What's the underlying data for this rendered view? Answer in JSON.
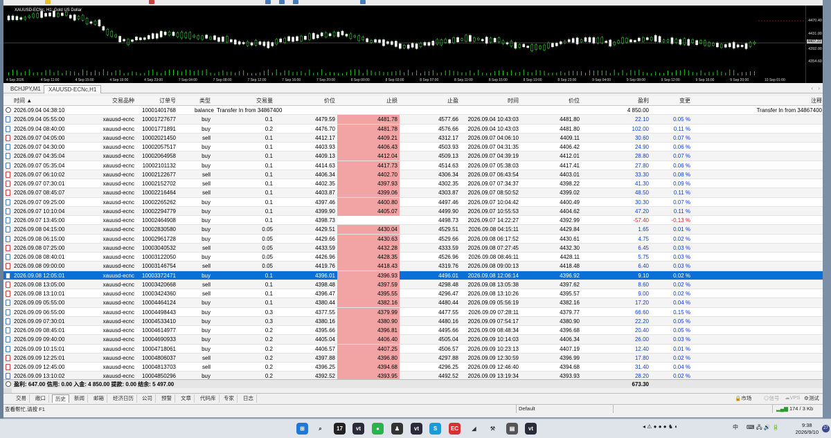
{
  "chart": {
    "title": "XAUUSD-ECNc, H1:  Gold US Dollar",
    "scale_labels": [
      "4470.40",
      "4431.00",
      "4407.22",
      "4392.00",
      "4354.60"
    ],
    "current_price": "4407.22",
    "time_labels": [
      "4 Sep 2026",
      "4 Sep 11:00",
      "4 Sep 15:00",
      "4 Sep 19:00",
      "4 Sep 23:00",
      "7 Sep 04:00",
      "7 Sep 08:00",
      "7 Sep 12:00",
      "7 Sep 16:00",
      "7 Sep 20:00",
      "8 Sep 00:00",
      "8 Sep 03:00",
      "8 Sep 07:00",
      "8 Sep 11:00",
      "8 Sep 15:00",
      "8 Sep 19:00",
      "8 Sep 23:00",
      "9 Sep 04:00",
      "9 Sep 08:00",
      "9 Sep 12:00",
      "9 Sep 16:00",
      "9 Sep 20:00",
      "10 Sep 01:00"
    ]
  },
  "chart_tabs": [
    "BCHJPY,M1",
    "XAUUSD-ECNc,H1"
  ],
  "columns": [
    "时间",
    "交易品种",
    "订单号",
    "类型",
    "交易量",
    "价位",
    "止损",
    "止盈",
    "时间",
    "价位",
    "盈利",
    "变更",
    "注释"
  ],
  "deposit": {
    "time": "2026.09.04 04:38:10",
    "order": "10001401768",
    "type": "balance",
    "comment": "Transfer In from 34867400",
    "profit": "4 850.00",
    "note": "Transfer In from 34867400"
  },
  "rows": [
    {
      "t": "2026.09.04 05:55:00",
      "sym": "xauusd-ecnc",
      "id": "10001727677",
      "type": "buy",
      "vol": "0.1",
      "p": "4479.59",
      "sl": "4481.78",
      "tp": "4577.66",
      "t2": "2026.09.04 10:43:03",
      "p2": "4481.80",
      "pr": "22.10",
      "ch": "0.05 %"
    },
    {
      "t": "2026.09.04 08:40:00",
      "sym": "xauusd-ecnc",
      "id": "10001771891",
      "type": "buy",
      "vol": "0.2",
      "p": "4476.70",
      "sl": "4481.78",
      "tp": "4576.66",
      "t2": "2026.09.04 10:43:03",
      "p2": "4481.80",
      "pr": "102.00",
      "ch": "0.11 %"
    },
    {
      "t": "2026.09.07 04:05:00",
      "sym": "xauusd-ecnc",
      "id": "10002021450",
      "type": "sell",
      "vol": "0.1",
      "p": "4412.17",
      "sl": "4409.21",
      "tp": "4312.17",
      "t2": "2026.09.07 04:06:10",
      "p2": "4409.11",
      "pr": "30.60",
      "ch": "0.07 %"
    },
    {
      "t": "2026.09.07 04:30:00",
      "sym": "xauusd-ecnc",
      "id": "10002057517",
      "type": "buy",
      "vol": "0.1",
      "p": "4403.93",
      "sl": "4406.43",
      "tp": "4503.93",
      "t2": "2026.09.07 04:31:35",
      "p2": "4406.42",
      "pr": "24.90",
      "ch": "0.06 %"
    },
    {
      "t": "2026.09.07 04:35:04",
      "sym": "xauusd-ecnc",
      "id": "10002064958",
      "type": "buy",
      "vol": "0.1",
      "p": "4409.13",
      "sl": "4412.04",
      "tp": "4509.13",
      "t2": "2026.09.07 04:39:19",
      "p2": "4412.01",
      "pr": "28.80",
      "ch": "0.07 %"
    },
    {
      "t": "2026.09.07 05:35:04",
      "sym": "xauusd-ecnc",
      "id": "10002101132",
      "type": "buy",
      "vol": "0.1",
      "p": "4414.63",
      "sl": "4417.73",
      "tp": "4514.63",
      "t2": "2026.09.07 05:38:03",
      "p2": "4417.41",
      "pr": "27.80",
      "ch": "0.06 %"
    },
    {
      "t": "2026.09.07 06:10:02",
      "sym": "xauusd-ecnc",
      "id": "10002122677",
      "type": "sell",
      "vol": "0.1",
      "p": "4406.34",
      "sl": "4402.70",
      "tp": "4306.34",
      "t2": "2026.09.07 06:43:54",
      "p2": "4403.01",
      "pr": "33.30",
      "ch": "0.08 %"
    },
    {
      "t": "2026.09.07 07:30:01",
      "sym": "xauusd-ecnc",
      "id": "10002152702",
      "type": "sell",
      "vol": "0.1",
      "p": "4402.35",
      "sl": "4397.93",
      "tp": "4302.35",
      "t2": "2026.09.07 07:34:37",
      "p2": "4398.22",
      "pr": "41.30",
      "ch": "0.09 %"
    },
    {
      "t": "2026.09.07 08:45:07",
      "sym": "xauusd-ecnc",
      "id": "10002216464",
      "type": "sell",
      "vol": "0.1",
      "p": "4403.87",
      "sl": "4399.06",
      "tp": "4303.87",
      "t2": "2026.09.07 08:50:52",
      "p2": "4399.02",
      "pr": "48.50",
      "ch": "0.11 %"
    },
    {
      "t": "2026.09.07 09:25:00",
      "sym": "xauusd-ecnc",
      "id": "10002265262",
      "type": "buy",
      "vol": "0.1",
      "p": "4397.46",
      "sl": "4400.80",
      "tp": "4497.46",
      "t2": "2026.09.07 10:04:42",
      "p2": "4400.49",
      "pr": "30.30",
      "ch": "0.07 %"
    },
    {
      "t": "2026.09.07 10:10:04",
      "sym": "xauusd-ecnc",
      "id": "10002294779",
      "type": "buy",
      "vol": "0.1",
      "p": "4399.90",
      "sl": "4405.07",
      "tp": "4499.90",
      "t2": "2026.09.07 10:55:53",
      "p2": "4404.62",
      "pr": "47.20",
      "ch": "0.11 %"
    },
    {
      "t": "2026.09.07 13:45:00",
      "sym": "xauusd-ecnc",
      "id": "10002464908",
      "type": "buy",
      "vol": "0.1",
      "p": "4398.73",
      "sl": "",
      "tp": "4498.73",
      "t2": "2026.09.07 14:22:27",
      "p2": "4392.99",
      "pr": "-57.40",
      "ch": "-0.13 %",
      "neg": true
    },
    {
      "t": "2026.09.08 04:15:00",
      "sym": "xauusd-ecnc",
      "id": "10002830580",
      "type": "buy",
      "vol": "0.05",
      "p": "4429.51",
      "sl": "4430.04",
      "tp": "4529.51",
      "t2": "2026.09.08 04:15:11",
      "p2": "4429.84",
      "pr": "1.65",
      "ch": "0.01 %"
    },
    {
      "t": "2026.09.08 06:15:00",
      "sym": "xauusd-ecnc",
      "id": "10002961728",
      "type": "buy",
      "vol": "0.05",
      "p": "4429.66",
      "sl": "4430.63",
      "tp": "4529.66",
      "t2": "2026.09.08 06:17:52",
      "p2": "4430.61",
      "pr": "4.75",
      "ch": "0.02 %"
    },
    {
      "t": "2026.09.08 07:25:00",
      "sym": "xauusd-ecnc",
      "id": "10003040532",
      "type": "sell",
      "vol": "0.05",
      "p": "4433.59",
      "sl": "4432.28",
      "tp": "4333.59",
      "t2": "2026.09.08 07:27:45",
      "p2": "4432.30",
      "pr": "6.45",
      "ch": "0.03 %"
    },
    {
      "t": "2026.09.08 08:40:01",
      "sym": "xauusd-ecnc",
      "id": "10003122050",
      "type": "buy",
      "vol": "0.05",
      "p": "4426.96",
      "sl": "4428.35",
      "tp": "4526.96",
      "t2": "2026.09.08 08:46:11",
      "p2": "4428.11",
      "pr": "5.75",
      "ch": "0.03 %"
    },
    {
      "t": "2026.09.08 09:00:00",
      "sym": "xauusd-ecnc",
      "id": "10003146754",
      "type": "sell",
      "vol": "0.05",
      "p": "4419.76",
      "sl": "4418.43",
      "tp": "4319.76",
      "t2": "2026.09.08 09:00:13",
      "p2": "4418.48",
      "pr": "6.40",
      "ch": "0.03 %"
    },
    {
      "t": "2026.09.08 12:05:01",
      "sym": "xauusd-ecnc",
      "id": "10003372471",
      "type": "buy",
      "vol": "0.1",
      "p": "4396.01",
      "sl": "4396.93",
      "tp": "4496.01",
      "t2": "2026.09.08 12:06:14",
      "p2": "4396.92",
      "pr": "9.10",
      "ch": "0.02 %",
      "sel": true
    },
    {
      "t": "2026.09.08 13:05:00",
      "sym": "xauusd-ecnc",
      "id": "10003420668",
      "type": "sell",
      "vol": "0.1",
      "p": "4398.48",
      "sl": "4397.59",
      "tp": "4298.48",
      "t2": "2026.09.08 13:05:38",
      "p2": "4397.62",
      "pr": "8.60",
      "ch": "0.02 %"
    },
    {
      "t": "2026.09.08 13:10:01",
      "sym": "xauusd-ecnc",
      "id": "10003424360",
      "type": "sell",
      "vol": "0.1",
      "p": "4396.47",
      "sl": "4395.55",
      "tp": "4296.47",
      "t2": "2026.09.08 13:10:26",
      "p2": "4395.57",
      "pr": "9.00",
      "ch": "0.02 %"
    },
    {
      "t": "2026.09.09 05:55:00",
      "sym": "xauusd-ecnc",
      "id": "10004464124",
      "type": "buy",
      "vol": "0.1",
      "p": "4380.44",
      "sl": "4382.16",
      "tp": "4480.44",
      "t2": "2026.09.09 05:56:19",
      "p2": "4382.16",
      "pr": "17.20",
      "ch": "0.04 %"
    },
    {
      "t": "2026.09.09 06:55:00",
      "sym": "xauusd-ecnc",
      "id": "10004498443",
      "type": "buy",
      "vol": "0.3",
      "p": "4377.55",
      "sl": "4379.99",
      "tp": "4477.55",
      "t2": "2026.09.09 07:28:11",
      "p2": "4379.77",
      "pr": "66.60",
      "ch": "0.15 %"
    },
    {
      "t": "2026.09.09 07:30:01",
      "sym": "xauusd-ecnc",
      "id": "10004533410",
      "type": "buy",
      "vol": "0.3",
      "p": "4380.16",
      "sl": "4380.90",
      "tp": "4480.16",
      "t2": "2026.09.09 07:54:17",
      "p2": "4380.90",
      "pr": "22.20",
      "ch": "0.05 %"
    },
    {
      "t": "2026.09.09 08:45:01",
      "sym": "xauusd-ecnc",
      "id": "10004614977",
      "type": "buy",
      "vol": "0.2",
      "p": "4395.66",
      "sl": "4396.81",
      "tp": "4495.66",
      "t2": "2026.09.09 08:48:34",
      "p2": "4396.68",
      "pr": "20.40",
      "ch": "0.05 %"
    },
    {
      "t": "2026.09.09 09:40:00",
      "sym": "xauusd-ecnc",
      "id": "10004690933",
      "type": "buy",
      "vol": "0.2",
      "p": "4405.04",
      "sl": "4406.40",
      "tp": "4505.04",
      "t2": "2026.09.09 10:14:03",
      "p2": "4406.34",
      "pr": "26.00",
      "ch": "0.03 %"
    },
    {
      "t": "2026.09.09 10:15:01",
      "sym": "xauusd-ecnc",
      "id": "10004718061",
      "type": "buy",
      "vol": "0.2",
      "p": "4406.57",
      "sl": "4407.25",
      "tp": "4506.57",
      "t2": "2026.09.09 10:23:13",
      "p2": "4407.19",
      "pr": "12.40",
      "ch": "0.01 %"
    },
    {
      "t": "2026.09.09 12:25:01",
      "sym": "xauusd-ecnc",
      "id": "10004806037",
      "type": "sell",
      "vol": "0.2",
      "p": "4397.88",
      "sl": "4396.80",
      "tp": "4297.88",
      "t2": "2026.09.09 12:30:59",
      "p2": "4396.99",
      "pr": "17.80",
      "ch": "0.02 %"
    },
    {
      "t": "2026.09.09 12:45:00",
      "sym": "xauusd-ecnc",
      "id": "10004813703",
      "type": "sell",
      "vol": "0.2",
      "p": "4396.25",
      "sl": "4394.68",
      "tp": "4296.25",
      "t2": "2026.09.09 12:46:40",
      "p2": "4394.68",
      "pr": "31.40",
      "ch": "0.04 %"
    },
    {
      "t": "2026.09.09 13:10:02",
      "sym": "xauusd-ecnc",
      "id": "10004850296",
      "type": "buy",
      "vol": "0.2",
      "p": "4392.52",
      "sl": "4393.95",
      "tp": "4492.52",
      "t2": "2026.09.09 13:19:34",
      "p2": "4393.93",
      "pr": "28.20",
      "ch": "0.02 %"
    }
  ],
  "summary": {
    "text": "盈利: 647.00  信用: 0.00  入金: 4 850.00  提款: 0.00  结余: 5 497.00",
    "total": "673.30"
  },
  "bottom_tabs": [
    "交易",
    "敞口",
    "历史",
    "新闻",
    "邮箱",
    "经济日历",
    "公司",
    "预警",
    "文章",
    "代码库",
    "专家",
    "日志"
  ],
  "active_tab": "历史",
  "bottom_right": [
    "市场",
    "信号",
    "VPS",
    "测试"
  ],
  "status": {
    "help": "查看帮忙,请按 F1",
    "profile": "Default",
    "traffic": "174 / 3 Kb"
  },
  "taskbar": {
    "time": "9:38",
    "date": "2026/9/10",
    "lang": "中",
    "notif": "27"
  }
}
